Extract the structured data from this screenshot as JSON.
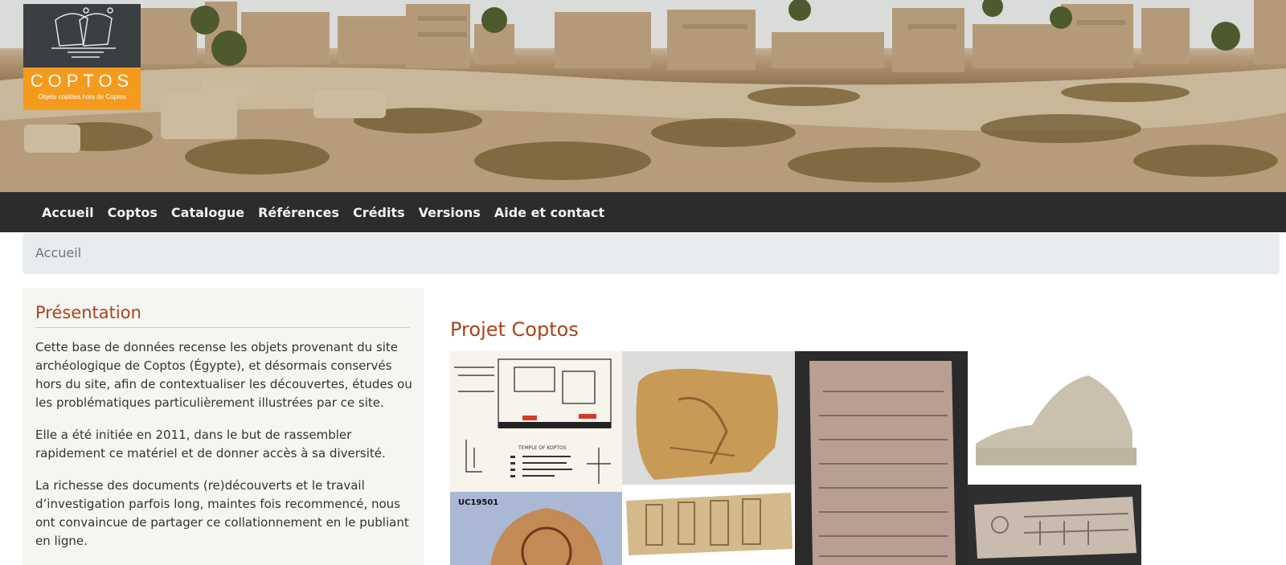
{
  "header": {
    "logo": {
      "wordmark": "COPTOS",
      "tagline": "Objets coptites hors de Coptos"
    }
  },
  "nav": {
    "items": [
      {
        "label": "Accueil"
      },
      {
        "label": "Coptos"
      },
      {
        "label": "Catalogue"
      },
      {
        "label": "Références"
      },
      {
        "label": "Crédits"
      },
      {
        "label": "Versions"
      },
      {
        "label": "Aide et contact"
      }
    ]
  },
  "breadcrumb": {
    "current": "Accueil"
  },
  "presentation": {
    "title": "Présentation",
    "paragraphs": [
      "Cette base de données recense les objets provenant du site archéologique de Coptos (Égypte), et désormais conservés hors du site, afin de contextualiser les découvertes, études ou les problématiques particulièrement illustrées par ce site.",
      "Elle a été initiée en 2011, dans le but de rassembler rapidement ce matériel et de donner accès à sa diversité.",
      "La richesse des documents (re)découverts et le travail d’investigation parfois long, maintes fois recommencé, nous ont convaincue de partager ce collationnement en le publiant en ligne."
    ]
  },
  "project": {
    "title": "Projet Coptos",
    "gallery": [
      {
        "id": "plan",
        "caption": "TEMPLE OF KOPTOS"
      },
      {
        "id": "relief-stone"
      },
      {
        "id": "greek-stele"
      },
      {
        "id": "crocodile-figurine"
      },
      {
        "id": "vase-fragment",
        "caption": "UC19501"
      },
      {
        "id": "hieroglyph-block"
      },
      {
        "id": "inscribed-fragment"
      }
    ]
  },
  "colors": {
    "nav_bg": "#2c2c2c",
    "heading": "#a8441c",
    "logo_orange": "#f49a1d",
    "logo_dark": "#3b3f42",
    "panel_bg": "#f5f5f1",
    "breadcrumb_bg": "#e9ecef"
  }
}
